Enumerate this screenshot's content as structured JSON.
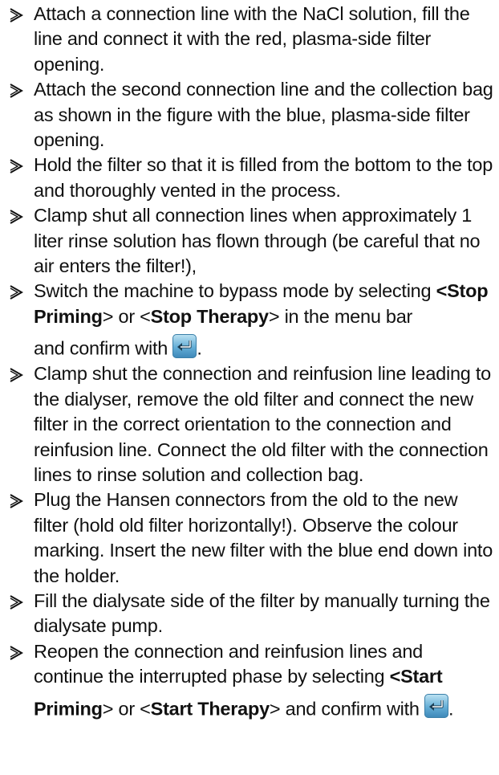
{
  "steps": [
    {
      "text": "Attach a connection line with the NaCl solution, fill the line and connect it with the red, plasma-side filter opening."
    },
    {
      "text": "Attach the second connection line and the collection bag as shown in the figure with the blue, plasma-side filter opening."
    },
    {
      "text": "Hold the filter so that it is filled from the bottom to the top and thoroughly vented in the process."
    },
    {
      "text": "Clamp shut all connection lines when approximately 1 liter rinse solution has flown through (be careful that no air enters the filter!),"
    },
    {
      "pre": "Switch the machine to bypass mode by selecting ",
      "open1": "<",
      "bold1": "Stop Priming",
      "close1": ">",
      "mid": " or <",
      "bold2": "Stop Therapy",
      "post": "> in the menu bar",
      "confirm": "and confirm with ",
      "end": "."
    },
    {
      "text": "Clamp shut the connection and reinfusion line leading to the dialyser, remove the old filter and connect the new filter in the correct orientation to the connection and reinfusion line. Connect the old filter with the connection lines to rinse solution and collection bag."
    },
    {
      "text": "Plug the Hansen connectors from the old to the new filter (hold old filter horizontally!). Observe the colour marking. Insert the new filter with the blue end down into the holder."
    },
    {
      "text": "Fill the dialysate side of the filter by manually turning the dialysate pump."
    },
    {
      "pre": "Reopen the connection and reinfusion lines and continue the interrupted phase by selecting ",
      "bold1": "<Start",
      "bold1b": "Priming",
      "close1": ">",
      "mid": " or <",
      "bold2": "Start Therapy",
      "post": "> and confirm with ",
      "end": "."
    }
  ],
  "icons": {
    "bullet": "arrow-bullet-icon",
    "confirm": "enter-return-icon",
    "confirm_colors": [
      "#bfe3f3",
      "#64aed6",
      "#3c86b7"
    ]
  }
}
